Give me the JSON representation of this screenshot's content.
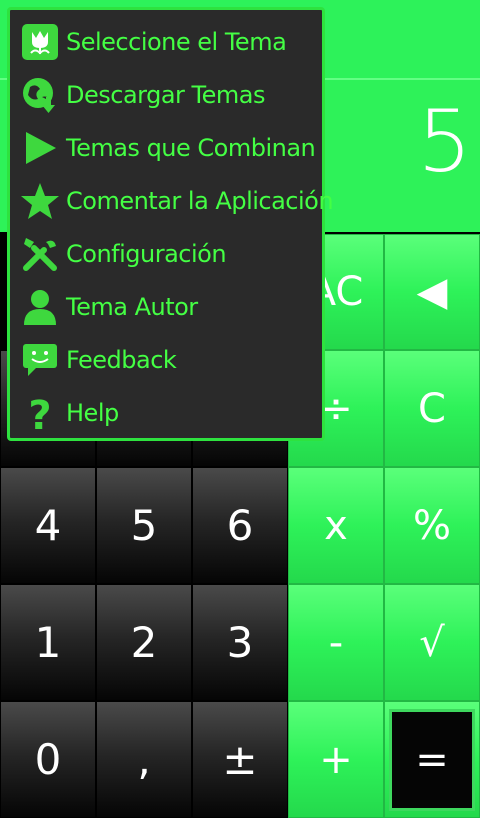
{
  "calculator": {
    "display_value": "5",
    "keys": {
      "all_clear": "AC",
      "backspace": "◀",
      "divide": "÷",
      "clear": "C",
      "four": "4",
      "five": "5",
      "six": "6",
      "multiply": "x",
      "percent": "%",
      "one": "1",
      "two": "2",
      "three": "3",
      "minus": "-",
      "sqrt": "√",
      "zero": "0",
      "comma": ",",
      "plus_minus": "±",
      "plus": "+",
      "equals": "="
    },
    "colors": {
      "accent": "#2ef259",
      "key_dark": "#262626",
      "menu_text": "#44ff44"
    }
  },
  "menu": {
    "items": [
      {
        "label": "Seleccione el Tema",
        "icon": "tulip-icon"
      },
      {
        "label": "Descargar Temas",
        "icon": "globe-download-icon"
      },
      {
        "label": "Temas que Combinan",
        "icon": "play-store-icon"
      },
      {
        "label": "Comentar la Aplicación",
        "icon": "star-icon"
      },
      {
        "label": "Configuración",
        "icon": "tools-icon"
      },
      {
        "label": "Tema Autor",
        "icon": "user-icon"
      },
      {
        "label": "Feedback",
        "icon": "chat-smile-icon"
      },
      {
        "label": "Help",
        "icon": "question-icon"
      }
    ]
  }
}
